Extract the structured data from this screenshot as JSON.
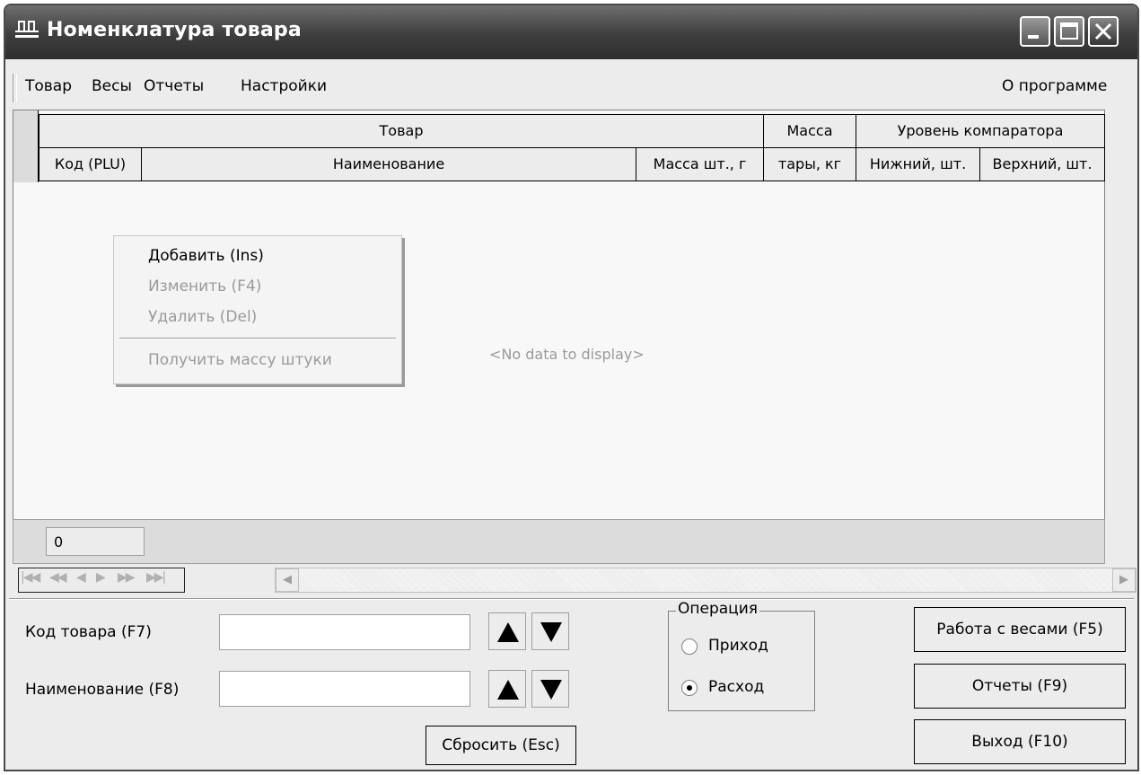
{
  "window": {
    "title": "Номенклатура товара"
  },
  "menu": {
    "items": [
      "Товар",
      "Весы",
      "Отчеты",
      "Настройки"
    ],
    "about": "О программе"
  },
  "grid": {
    "band_headers": [
      "Товар",
      "Масса",
      "Уровень компаратора"
    ],
    "columns": [
      "Код (PLU)",
      "Наименование",
      "Масса шт., г",
      "тары, кг",
      "Нижний, шт.",
      "Верхний, шт."
    ],
    "empty_text": "<No data to display>",
    "footer_value": "0"
  },
  "context_menu": {
    "items": [
      {
        "label": "Добавить (Ins)",
        "enabled": true
      },
      {
        "label": "Изменить (F4)",
        "enabled": false
      },
      {
        "label": "Удалить (Del)",
        "enabled": false
      },
      {
        "label": "Получить массу штуки",
        "enabled": false
      }
    ]
  },
  "search": {
    "code_label": "Код товара (F7)",
    "code_value": "",
    "name_label": "Наименование (F8)",
    "name_value": "",
    "reset_label": "Сбросить (Esc)"
  },
  "operation": {
    "title": "Операция",
    "options": [
      "Приход",
      "Расход"
    ],
    "selected": "Расход"
  },
  "buttons": {
    "scales": "Работа с весами (F5)",
    "reports": "Отчеты (F9)",
    "exit": "Выход (F10)"
  },
  "colors": {
    "titlebar": "#3e3e3e",
    "background": "#ececec",
    "disabled_text": "#9a9a9a"
  },
  "icons": [
    "scales-app-icon",
    "minimize-icon",
    "maximize-icon",
    "close-icon",
    "first-record-icon",
    "prev-page-icon",
    "prev-record-icon",
    "next-record-icon",
    "next-page-icon",
    "last-record-icon",
    "scroll-left-icon",
    "scroll-right-icon",
    "arrow-up-icon",
    "arrow-down-icon"
  ]
}
